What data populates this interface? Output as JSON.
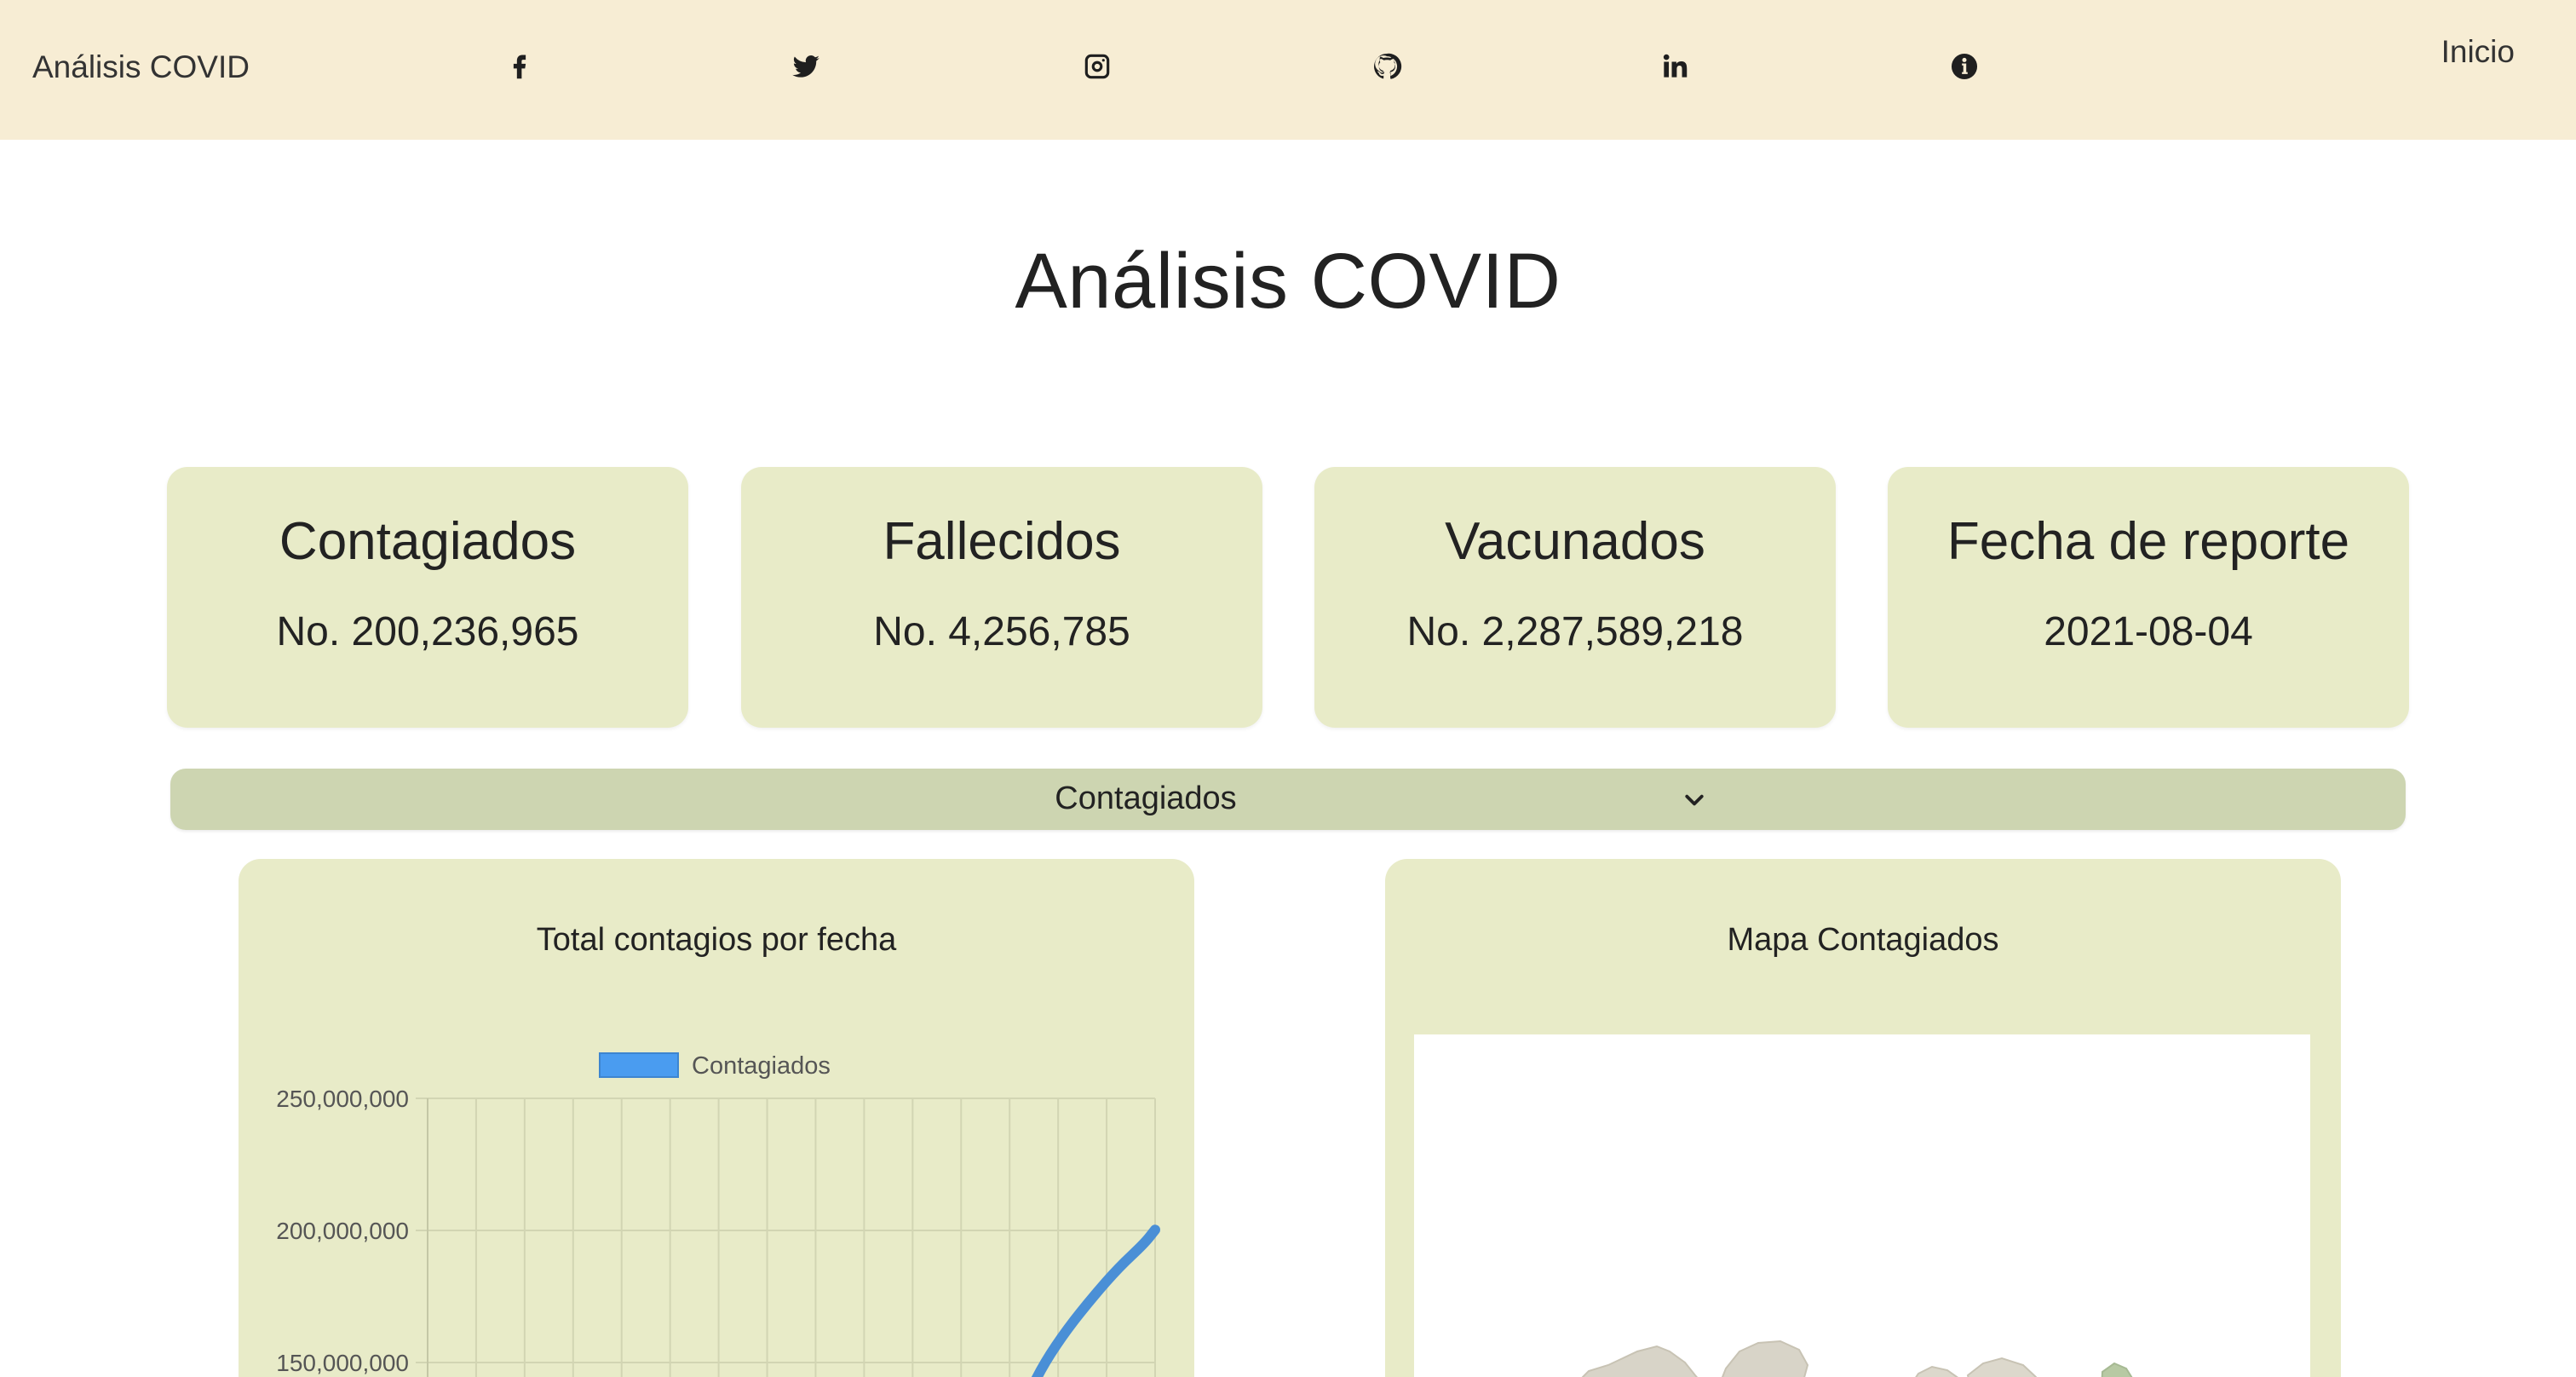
{
  "navbar": {
    "brand": "Análisis COVID",
    "social_icons": [
      "facebook-icon",
      "twitter-icon",
      "instagram-icon",
      "github-icon",
      "linkedin-icon",
      "info-icon"
    ],
    "inicio_label": "Inicio",
    "background_color": "#f7edd4"
  },
  "page": {
    "title": "Análisis COVID"
  },
  "cards": [
    {
      "title": "Contagiados",
      "value": "No. 200,236,965"
    },
    {
      "title": "Fallecidos",
      "value": "No. 4,256,785"
    },
    {
      "title": "Vacunados",
      "value": "No. 2,287,589,218"
    },
    {
      "title": "Fecha de reporte",
      "value": "2021-08-04"
    }
  ],
  "select": {
    "selected": "Contagiados",
    "icon": "chevron-down-icon",
    "background_color": "#cdd5b1"
  },
  "chart_panel": {
    "title": "Total contagios por fecha"
  },
  "map_panel": {
    "title": "Mapa Contagiados"
  },
  "colors": {
    "card_bg": "#e8ebc8",
    "series_line": "#4a8fd6",
    "series_legend": "#4a9cf0"
  },
  "chart_data": {
    "type": "line",
    "title": "Total contagios por fecha",
    "xlabel": "",
    "ylabel": "",
    "legend_position": "top-center",
    "grid": true,
    "ylim": [
      140000000,
      250000000
    ],
    "y_ticks": [
      250000000,
      200000000,
      150000000
    ],
    "y_tick_labels": [
      "250,000,000",
      "200,000,000",
      "150,000,000"
    ],
    "series": [
      {
        "name": "Contagiados",
        "color": "#4a8fd6",
        "points": [
          [
            0.826,
            138000000
          ],
          [
            0.848,
            150000000
          ],
          [
            0.88,
            163000000
          ],
          [
            0.915,
            175000000
          ],
          [
            0.95,
            186000000
          ],
          [
            0.985,
            195000000
          ],
          [
            1.0,
            200236965
          ]
        ]
      }
    ]
  }
}
